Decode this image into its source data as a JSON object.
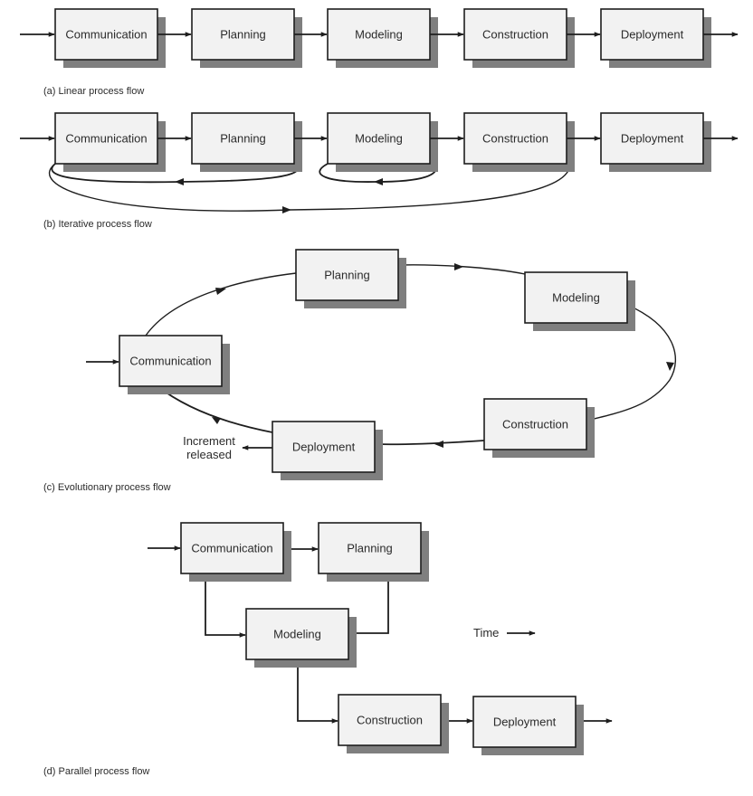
{
  "sections": {
    "linear": {
      "caption": "(a) Linear process flow",
      "activities": [
        "Communication",
        "Planning",
        "Modeling",
        "Construction",
        "Deployment"
      ]
    },
    "iterative": {
      "caption": "(b) Iterative process flow",
      "activities": [
        "Communication",
        "Planning",
        "Modeling",
        "Construction",
        "Deployment"
      ],
      "feedback_loops": [
        {
          "from": "Planning",
          "to": "Communication"
        },
        {
          "from": "Modeling",
          "to": "Modeling"
        },
        {
          "from": "Construction",
          "to": "Communication"
        }
      ]
    },
    "evolutionary": {
      "caption": "(c) Evolutionary process flow",
      "activities": [
        "Communication",
        "Planning",
        "Modeling",
        "Construction",
        "Deployment"
      ],
      "output_label_line1": "Increment",
      "output_label_line2": "released"
    },
    "parallel": {
      "caption": "(d) Parallel process flow",
      "activities": [
        "Communication",
        "Planning",
        "Modeling",
        "Construction",
        "Deployment"
      ],
      "time_label": "Time"
    }
  },
  "colors": {
    "box_fill": "#f2f2f2",
    "box_stroke": "#1e1e1e",
    "shadow": "#7f7f7f",
    "text": "#2b2b2b"
  }
}
